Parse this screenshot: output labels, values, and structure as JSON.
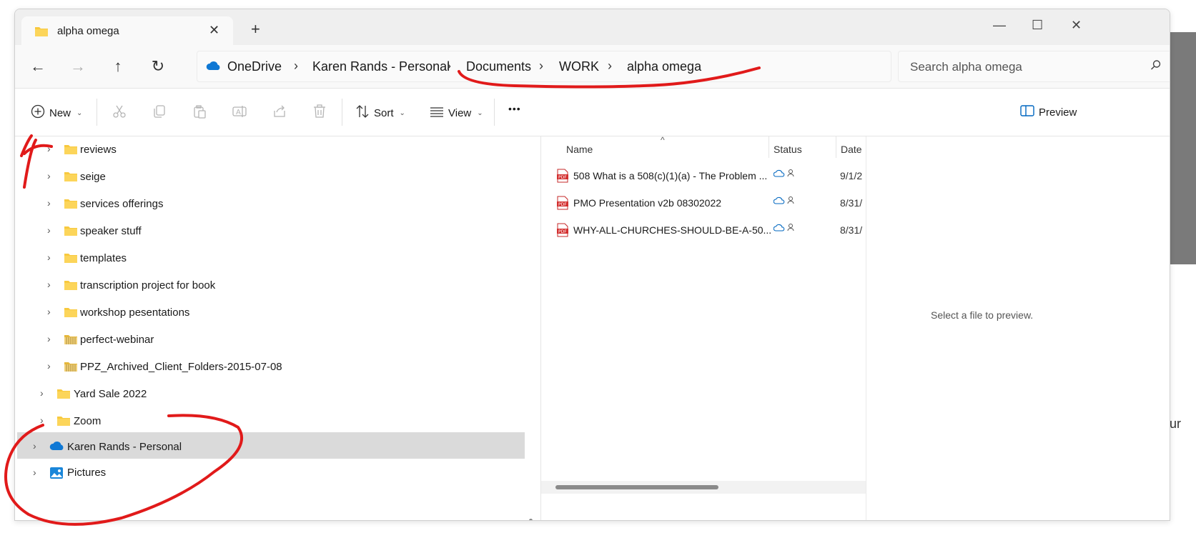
{
  "window": {
    "tab_title": "alpha omega",
    "tab_close": "✕",
    "new_tab": "+",
    "controls": {
      "minimize": "—",
      "maximize": "☐",
      "close": "✕"
    }
  },
  "nav": {
    "back": "←",
    "forward": "→",
    "up": "↑",
    "refresh": "↻"
  },
  "breadcrumb": [
    "OneDrive",
    "Karen Rands - Personal",
    "Documents",
    "WORK",
    "alpha omega"
  ],
  "breadcrumb_sep": "›",
  "search": {
    "placeholder": "Search alpha omega"
  },
  "toolbar": {
    "new_label": "New",
    "sort_label": "Sort",
    "view_label": "View",
    "more_label": "•••",
    "preview_label": "Preview"
  },
  "tree": {
    "chevron": "›",
    "items": [
      {
        "label": "reviews",
        "icon": "folder-icon"
      },
      {
        "label": "seige",
        "icon": "folder-icon"
      },
      {
        "label": "services offerings",
        "icon": "folder-icon"
      },
      {
        "label": "speaker stuff",
        "icon": "folder-icon"
      },
      {
        "label": "templates",
        "icon": "folder-icon"
      },
      {
        "label": "transcription project for book",
        "icon": "folder-icon"
      },
      {
        "label": "workshop pesentations",
        "icon": "folder-icon"
      },
      {
        "label": "perfect-webinar",
        "icon": "zip-folder-icon"
      },
      {
        "label": "PPZ_Archived_Client_Folders-2015-07-08",
        "icon": "zip-folder-icon"
      },
      {
        "label": "Yard Sale 2022",
        "icon": "folder-icon"
      },
      {
        "label": "Zoom",
        "icon": "folder-icon"
      },
      {
        "label": "Karen Rands - Personal",
        "icon": "onedrive-cloud-icon"
      },
      {
        "label": "Pictures",
        "icon": "pictures-icon"
      }
    ]
  },
  "columns": {
    "name": "Name",
    "status": "Status",
    "date": "Date",
    "sort_indicator": "^"
  },
  "files": [
    {
      "name": "508 What is a 508(c)(1)(a) - The Problem ...",
      "date": "9/1/2",
      "icon": "pdf-icon",
      "status": "cloud-shared"
    },
    {
      "name": "PMO Presentation v2b 08302022",
      "date": "8/31/",
      "icon": "pdf-icon",
      "status": "cloud-shared"
    },
    {
      "name": "WHY-ALL-CHURCHES-SHOULD-BE-A-50...",
      "date": "8/31/",
      "icon": "pdf-icon",
      "status": "cloud-shared"
    }
  ],
  "preview": {
    "message": "Select a file to preview."
  },
  "background": {
    "partial_text": "ur"
  },
  "colors": {
    "accent": "#0067c0",
    "folder": "#f8c93e",
    "pdf": "#d32f2f",
    "annotation": "#e11a1a",
    "selected": "#dadada"
  }
}
